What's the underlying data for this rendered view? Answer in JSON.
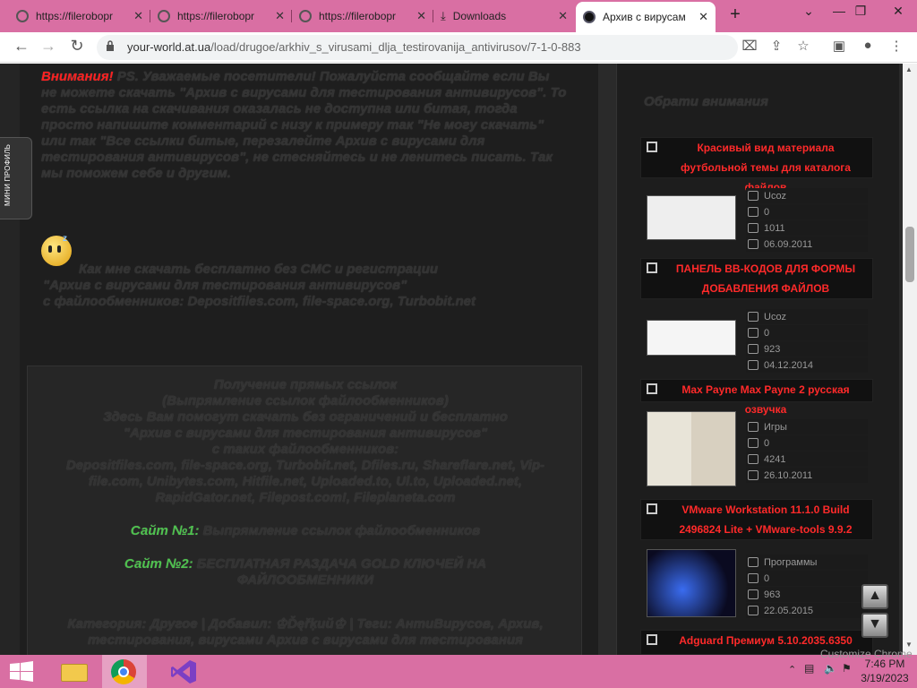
{
  "browser": {
    "tabs": [
      {
        "label": "https://filerobopr",
        "active": false
      },
      {
        "label": "https://filerobopr",
        "active": false
      },
      {
        "label": "https://filerobopr",
        "active": false
      },
      {
        "label": "Downloads",
        "active": false
      },
      {
        "label": "Архив с вирусам",
        "active": true
      }
    ],
    "url_domain": "your-world.at.ua",
    "url_path": "/load/drugoe/arkhiv_s_virusami_dlja_testirovanija_antivirusov/7-1-0-883"
  },
  "page": {
    "mini_profile": "МИНИ ПРОФИЛЬ",
    "warning_label": "Внимания!",
    "warning_text": " PS. Уважаемые посетители! Пожалуйста сообщайте если Вы не можете скачать \"Архив с вирусами для тестирования антивирусов\". То есть ссылка на скачивания оказалась не доступна или битая, тогда просто напишите комментарий с низу к примеру так \"Не могу скачать\" или так \"Все ссылки битые, перезалейте Архив с вирусами для тестирования антивирусов\", не стесняйтесь и не ленитесь писать. Так мы поможем себе и другим.",
    "howto_lines": [
      "Как мне скачать бесплатно без СМС и регистрации",
      "\"Архив с вирусами для тестирования антивирусов\"",
      "с файлообменников: Depositfiles.com, file-space.org, Turbobit.net"
    ],
    "box_lines": [
      "Получение прямых ссылок",
      "(Выпрямление ссылок файлообменников)",
      "Здесь Вам помогут скачать без ограничений и бесплатно",
      "\"Архив с вирусами для тестирования антивирусов\"",
      "с таких файлообменников:",
      "Depositfiles.com, file-space.org, Turbobit.net, Dfiles.ru, Shareflare.net, Vip-",
      "file.com, Unibytes.com, Hitfile.net, Uploaded.to, Ul.to, Uploaded.net,",
      "RapidGator.net, Filepost.com!, Fileplaneta.com"
    ],
    "site1_label": "Сайт №1:",
    "site1_text": " Выпрямление ссылок файлообменников",
    "site2_label": "Сайт №2:",
    "site2_text": " БЕСПЛАТНАЯ РАЗДАЧА GOLD КЛЮЧЕЙ НА",
    "site2_text2": "ФАЙЛООБМЕННИКИ",
    "category_line": "Категория: Другое | Добавил: ♔Ďęřķий♔ | Теги: АнтиВирусов, Архив,",
    "category_line2": "тестирования, вирусами Архив с вирусами для тестирования"
  },
  "sidebar": {
    "heading": "Обрати внимания",
    "items": [
      {
        "title": "Красивый вид материала футбольной темы для каталога файлов",
        "category": "Ucoz",
        "comments": "0",
        "views": "1011",
        "date": "06.09.2011"
      },
      {
        "title": "ПАНЕЛЬ BB-КОДОВ ДЛЯ ФОРМЫ ДОБАВЛЕНИЯ ФАЙЛОВ",
        "category": "Ucoz",
        "comments": "0",
        "views": "923",
        "date": "04.12.2014"
      },
      {
        "title": "Max Payne Max Payne 2 русская озвучка",
        "category": "Игры",
        "comments": "0",
        "views": "4241",
        "date": "26.10.2011"
      },
      {
        "title": "VMware Workstation 11.1.0 Build 2496824 Lite + VMware-tools 9.9.2",
        "category": "Программы",
        "comments": "0",
        "views": "963",
        "date": "22.05.2015"
      },
      {
        "title": "Adguard Премиум 5.10.2035.6350"
      }
    ]
  },
  "taskbar": {
    "time": "7:46 PM",
    "date": "3/19/2023",
    "customize_hint": "Customize Chrome"
  },
  "colors": {
    "accent": "#d96fa3",
    "red_title": "#ff2a2a",
    "green_link": "#4ec24e"
  }
}
